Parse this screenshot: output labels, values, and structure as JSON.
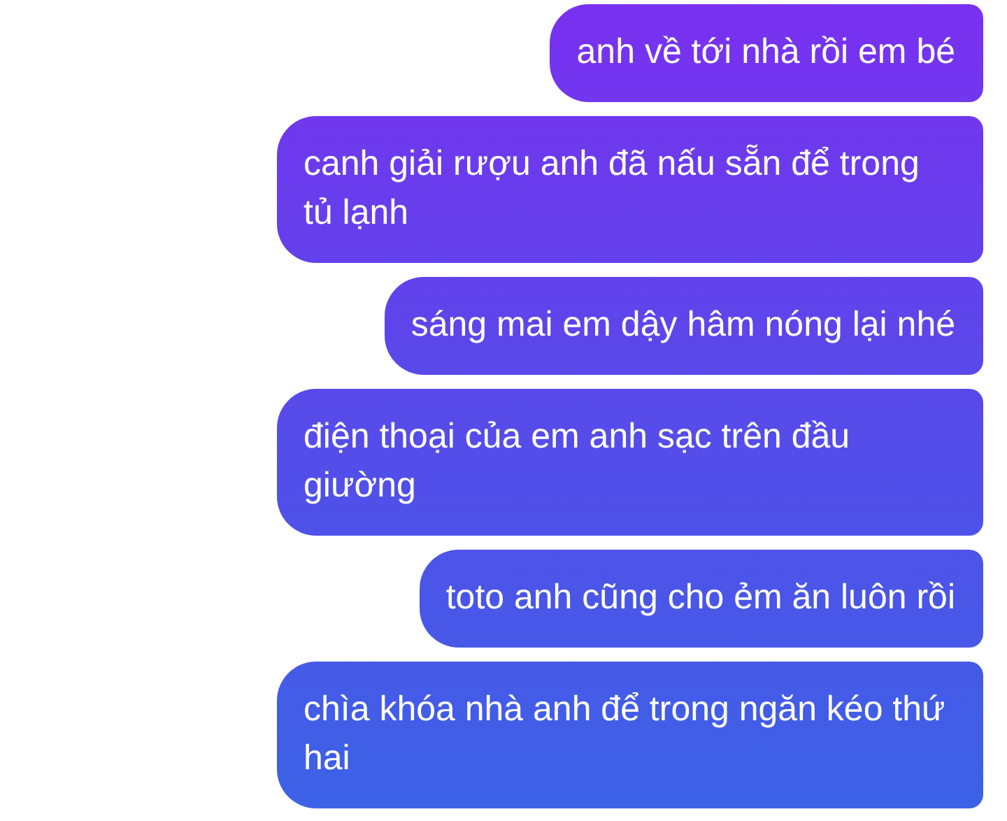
{
  "messages": [
    {
      "text": "anh về tới nhà rồi em bé"
    },
    {
      "text": "canh giải rượu anh đã nấu sẵn để trong tủ lạnh"
    },
    {
      "text": "sáng mai em dậy hâm nóng lại nhé"
    },
    {
      "text": "điện thoại của em anh sạc trên đầu giường"
    },
    {
      "text": "toto anh cũng cho ẻm ăn luôn rồi"
    },
    {
      "text": "chìa khóa nhà anh để trong ngăn kéo thứ hai"
    }
  ]
}
